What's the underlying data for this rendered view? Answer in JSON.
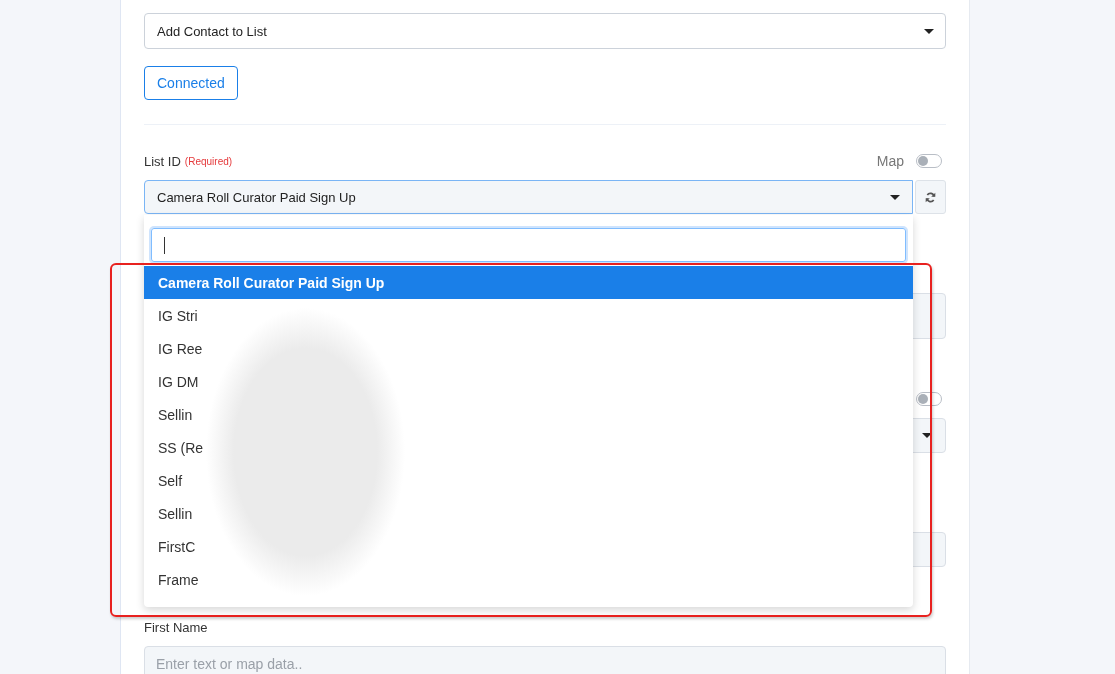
{
  "action_select": {
    "value": "Add Contact to List"
  },
  "connection_button": {
    "label": "Connected"
  },
  "list_id": {
    "label": "List ID",
    "required_note": "(Required)",
    "map_toggle": {
      "label": "Map",
      "on": false
    },
    "value": "Camera Roll Curator Paid Sign Up",
    "dropdown": {
      "expanded": true,
      "search": {
        "focused": true
      },
      "options": [
        {
          "label": "Camera Roll Curator Paid Sign Up",
          "selected": true
        },
        {
          "label": "IG Stri",
          "selected": false
        },
        {
          "label": "IG Ree",
          "selected": false
        },
        {
          "label": "IG DM",
          "selected": false
        },
        {
          "label": "Sellin",
          "selected": false
        },
        {
          "label": "SS (Re",
          "selected": false
        },
        {
          "label": "Self",
          "selected": false
        },
        {
          "label": "Sellin",
          "selected": false
        },
        {
          "label": "FirstC",
          "selected": false
        },
        {
          "label": "Frame",
          "selected": false
        }
      ]
    }
  },
  "hidden_fields": [
    {
      "kind": "textarea"
    },
    {
      "kind": "select",
      "map_toggle": {
        "on": false
      }
    },
    {
      "kind": "input"
    }
  ],
  "first_name": {
    "label": "First Name",
    "placeholder": "Enter text or map data.."
  }
}
